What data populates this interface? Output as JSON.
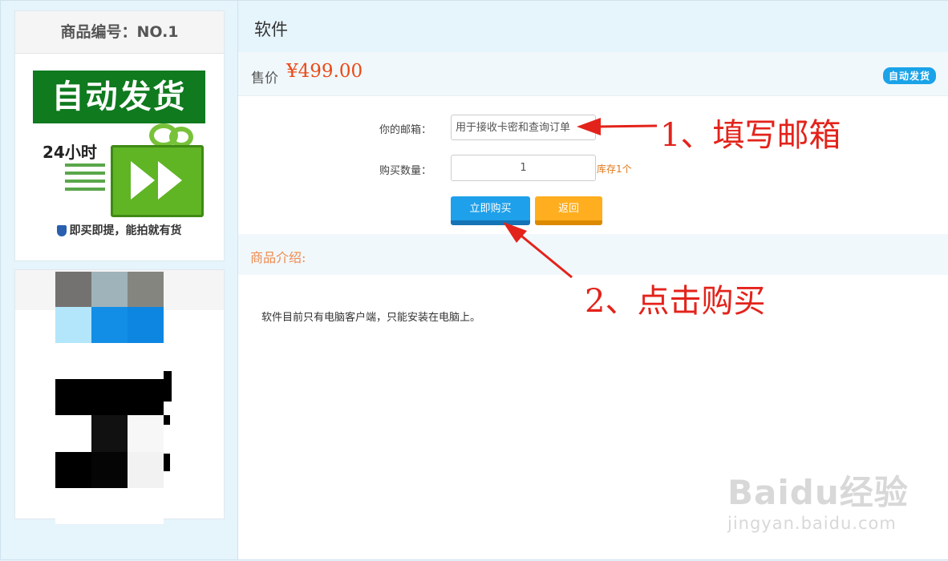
{
  "left": {
    "product_number": "商品编号：NO.1",
    "image": {
      "banner_text": "自动发货",
      "hours_text": "24小时",
      "footer_text": "即买即提，能拍就有货"
    }
  },
  "product": {
    "title": "软件",
    "price_label": "售价",
    "price": "¥499.00",
    "badge": "自动发货"
  },
  "form": {
    "email_label": "你的邮箱：",
    "email_placeholder": "用于接收卡密和查询订单",
    "quantity_label": "购买数量：",
    "quantity_value": "1",
    "stock": "库存1个",
    "buy_button": "立即购买",
    "back_button": "返回"
  },
  "intro": {
    "heading": "商品介绍:",
    "text": "软件目前只有电脑客户端，只能安装在电脑上。"
  },
  "annotations": {
    "step1": "1、填写邮箱",
    "step2": "2、点击购买",
    "color": "#e3231b"
  },
  "watermark": {
    "logo": "Baidu经验",
    "url": "jingyan.baidu.com"
  },
  "colors": {
    "price": "#ea4a17",
    "buy_button": "#1ea0ea",
    "back_button": "#ffae1f",
    "badge": "#1aa3e8"
  }
}
